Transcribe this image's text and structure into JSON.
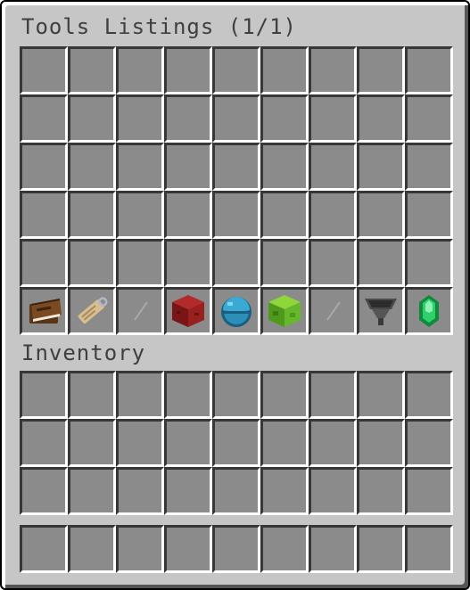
{
  "container": {
    "title": "Tools Listings (1/1)",
    "rows": 6,
    "columns": 9,
    "items": [
      {
        "index": 45,
        "icon": "book-icon"
      },
      {
        "index": 46,
        "icon": "name-tag-icon"
      },
      {
        "index": 47,
        "icon": "gray-glass-pane-icon"
      },
      {
        "index": 48,
        "icon": "red-block-icon"
      },
      {
        "index": 49,
        "icon": "ender-pearl-icon"
      },
      {
        "index": 50,
        "icon": "slime-block-icon"
      },
      {
        "index": 51,
        "icon": "gray-glass-pane-icon"
      },
      {
        "index": 52,
        "icon": "hopper-icon"
      },
      {
        "index": 53,
        "icon": "emerald-icon"
      }
    ]
  },
  "inventory": {
    "title": "Inventory",
    "main_rows": 3,
    "hotbar_rows": 1,
    "columns": 9
  },
  "colors": {
    "window_bg": "#c6c6c6",
    "slot_bg": "#8b8b8b",
    "title_text": "#3f3f3f"
  }
}
